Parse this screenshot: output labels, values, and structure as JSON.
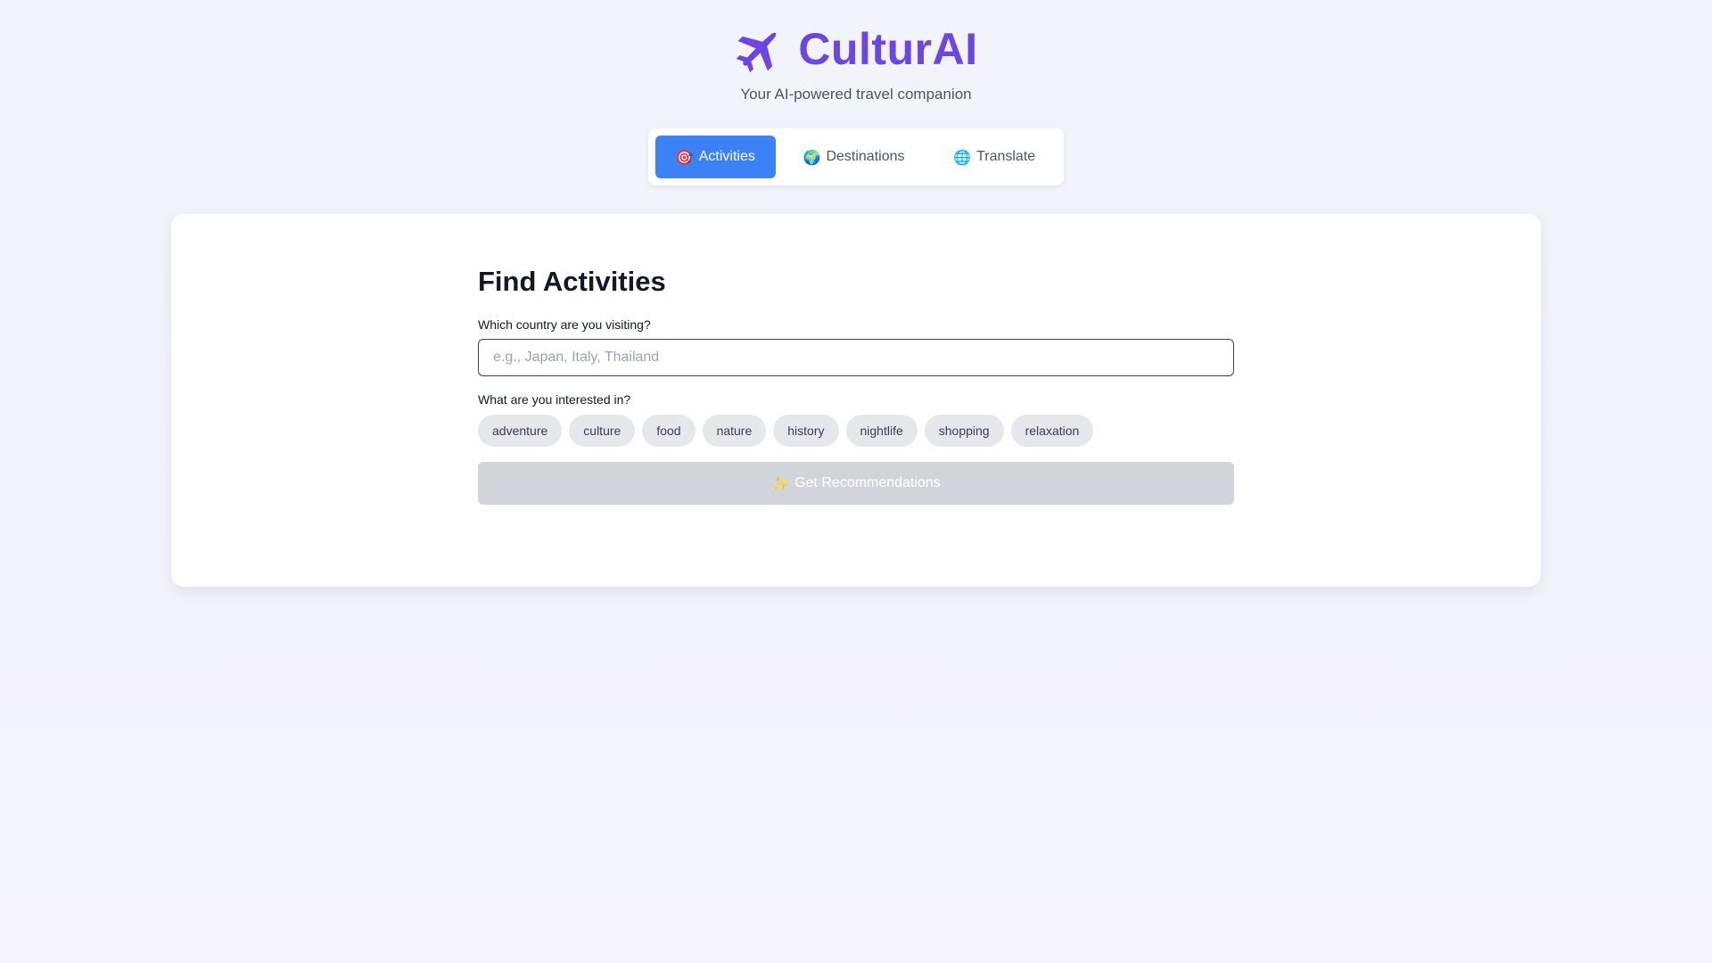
{
  "header": {
    "logo_icon": "airplane-icon",
    "title": "CulturAI",
    "tagline": "Your AI-powered travel companion",
    "brand_color": "#6d45e6"
  },
  "tabs": [
    {
      "icon": "🎯",
      "icon_name": "target-icon",
      "label": "Activities",
      "active": true
    },
    {
      "icon": "🌍",
      "icon_name": "globe-europe-africa-icon",
      "label": "Destinations",
      "active": false
    },
    {
      "icon": "🌐",
      "icon_name": "globe-meridians-icon",
      "label": "Translate",
      "active": false
    }
  ],
  "form": {
    "title": "Find Activities",
    "country_label": "Which country are you visiting?",
    "country_placeholder": "e.g., Japan, Italy, Thailand",
    "country_value": "",
    "interests_label": "What are you interested in?",
    "interests": [
      "adventure",
      "culture",
      "food",
      "nature",
      "history",
      "nightlife",
      "shopping",
      "relaxation"
    ],
    "submit_icon": "✨",
    "submit_label": "Get Recommendations",
    "submit_disabled": true
  },
  "colors": {
    "accent": "#3b82f6",
    "disabled_button": "#d1d5db",
    "chip_bg": "#e5e7eb"
  }
}
